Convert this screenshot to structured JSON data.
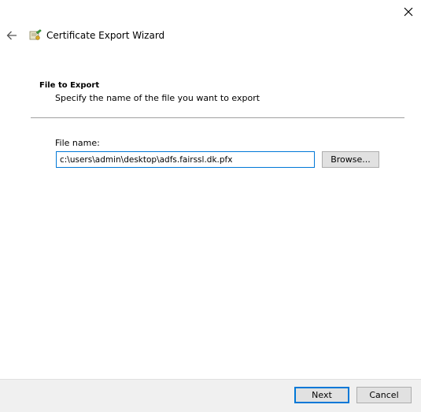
{
  "window": {
    "title": "Certificate Export Wizard",
    "close_icon": "close-icon",
    "back_icon": "back-arrow-icon",
    "app_icon": "certificate-icon"
  },
  "page": {
    "section_title": "File to Export",
    "section_description": "Specify the name of the file you want to export",
    "file_name_label": "File name:",
    "file_name_value": "c:\\users\\admin\\desktop\\adfs.fairssl.dk.pfx",
    "browse_label": "Browse..."
  },
  "footer": {
    "next_label": "Next",
    "cancel_label": "Cancel"
  },
  "colors": {
    "accent": "#0078d7",
    "footer_bg": "#f0f0f0",
    "button_bg": "#e1e1e1"
  }
}
